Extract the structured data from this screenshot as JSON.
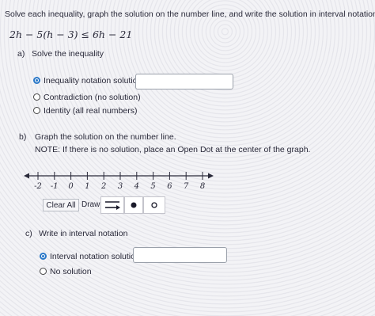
{
  "instructions": "Solve each inequality, graph the solution on the number line, and write the solution in interval notation.",
  "inequality": "2h − 5(h − 3) ≤ 6h − 21",
  "part_a": {
    "label": "a)",
    "prompt": "Solve the inequality",
    "options": [
      {
        "label": "Inequality notation solution",
        "selected": true
      },
      {
        "label": "Contradiction (no solution)",
        "selected": false
      },
      {
        "label": "Identity (all real numbers)",
        "selected": false
      }
    ],
    "input_value": ""
  },
  "part_b": {
    "label": "b)",
    "prompt": "Graph the solution on the number line.",
    "note": "NOTE: If there is no solution, place an Open Dot at the center of the graph.",
    "ticks": [
      "-2",
      "-1",
      "0",
      "1",
      "2",
      "3",
      "4",
      "5",
      "6",
      "7",
      "8"
    ],
    "clear_label": "Clear All",
    "draw_label": "Draw:",
    "tools": [
      "ray-tool-icon",
      "closed-dot-icon",
      "open-dot-icon"
    ]
  },
  "part_c": {
    "label": "c)",
    "prompt": "Write in interval notation",
    "options": [
      {
        "label": "Interval notation solution:",
        "selected": true
      },
      {
        "label": "No solution",
        "selected": false
      }
    ],
    "input_value": ""
  },
  "colors": {
    "accent": "#2a78c8",
    "text": "#2a2a3a"
  }
}
